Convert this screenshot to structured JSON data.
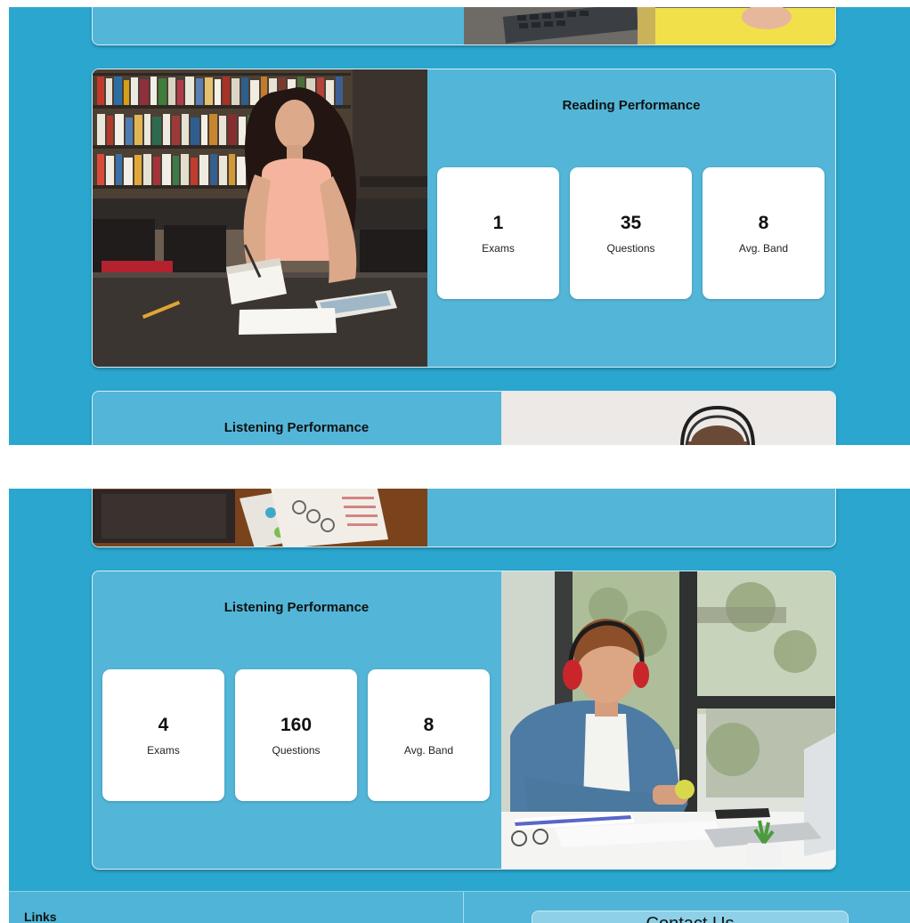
{
  "reading": {
    "title": "Reading Performance",
    "stats": [
      {
        "value": "1",
        "label": "Exams"
      },
      {
        "value": "35",
        "label": "Questions"
      },
      {
        "value": "8",
        "label": "Avg. Band"
      }
    ]
  },
  "listening_preview": {
    "title": "Listening Performance"
  },
  "listening": {
    "title": "Listening Performance",
    "stats": [
      {
        "value": "4",
        "label": "Exams"
      },
      {
        "value": "160",
        "label": "Questions"
      },
      {
        "value": "8",
        "label": "Avg. Band"
      }
    ]
  },
  "footer": {
    "links_heading": "Links",
    "contact_label": "Contact Us"
  },
  "colors": {
    "page_background": "#2ba7cf",
    "card_background": "#53b6d8",
    "stat_background": "#ffffff"
  }
}
